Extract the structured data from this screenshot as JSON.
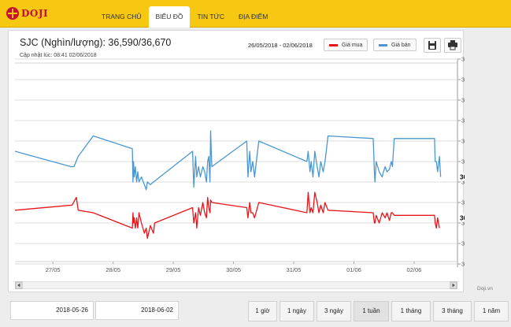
{
  "brand": {
    "name": "DOJI"
  },
  "nav": [
    {
      "label": "TRANG CHỦ"
    },
    {
      "label": "BIỂU ĐỒ"
    },
    {
      "label": "TIN TỨC"
    },
    {
      "label": "ĐỊA ĐIỂM"
    }
  ],
  "active_nav": 1,
  "header": {
    "title": "SJC (Nghìn/lượng): 36,590/36,670",
    "updated": "Cập nhật lúc: 08:41 02/06/2018",
    "date_range": "26/05/2018 - 02/06/2018"
  },
  "legend": {
    "buy_label": "Giá mua",
    "sell_label": "Giá bán"
  },
  "colors": {
    "buy": "#e8161b",
    "sell": "#4a98cf",
    "brand_bar": "#f6c811"
  },
  "icons": {
    "save": "save-icon",
    "print": "print-icon"
  },
  "chart_data": {
    "type": "line",
    "x_ticks": [
      "27/05",
      "28/05",
      "29/05",
      "30/05",
      "31/05",
      "01/06",
      "02/06"
    ],
    "y_ticks": [
      "36,900",
      "36,860",
      "36,820",
      "36,780",
      "36,740",
      "36,700",
      "36,660",
      "36,620",
      "36,580",
      "36,540",
      "36,500"
    ],
    "ylim": [
      36500,
      36900
    ],
    "xlim": [
      0,
      7.35
    ],
    "last_labels": {
      "buy": "36,590",
      "sell": "36,670"
    },
    "series": [
      {
        "name": "Giá bán",
        "color": "#4a98cf",
        "points": [
          [
            0,
            36720
          ],
          [
            0.93,
            36690
          ],
          [
            0.98,
            36690
          ],
          [
            1.05,
            36710
          ],
          [
            1.3,
            36750
          ],
          [
            1.95,
            36725
          ],
          [
            1.96,
            36660
          ],
          [
            1.97,
            36700
          ],
          [
            1.98,
            36670
          ],
          [
            2.0,
            36690
          ],
          [
            2.02,
            36660
          ],
          [
            2.04,
            36680
          ],
          [
            2.06,
            36660
          ],
          [
            2.1,
            36670
          ],
          [
            2.15,
            36655
          ],
          [
            2.18,
            36645
          ],
          [
            2.2,
            36660
          ],
          [
            2.25,
            36655
          ],
          [
            2.3,
            36660
          ],
          [
            2.95,
            36720
          ],
          [
            2.97,
            36650
          ],
          [
            3.0,
            36710
          ],
          [
            3.02,
            36670
          ],
          [
            3.05,
            36690
          ],
          [
            3.08,
            36670
          ],
          [
            3.12,
            36690
          ],
          [
            3.15,
            36680
          ],
          [
            3.18,
            36660
          ],
          [
            3.2,
            36700
          ],
          [
            3.22,
            36710
          ],
          [
            3.24,
            36660
          ],
          [
            3.25,
            36760
          ],
          [
            3.27,
            36690
          ],
          [
            3.85,
            36740
          ],
          [
            3.87,
            36670
          ],
          [
            3.9,
            36720
          ],
          [
            3.92,
            36680
          ],
          [
            3.95,
            36700
          ],
          [
            3.98,
            36670
          ],
          [
            4.05,
            36740
          ],
          [
            4.85,
            36700
          ],
          [
            4.87,
            36720
          ],
          [
            4.9,
            36680
          ],
          [
            4.92,
            36700
          ],
          [
            4.95,
            36670
          ],
          [
            4.98,
            36720
          ],
          [
            5.02,
            36690
          ],
          [
            5.05,
            36670
          ],
          [
            5.08,
            36700
          ],
          [
            5.12,
            36680
          ],
          [
            5.15,
            36700
          ],
          [
            5.2,
            36750
          ],
          [
            5.95,
            36745
          ],
          [
            5.97,
            36680
          ],
          [
            5.98,
            36660
          ],
          [
            6.0,
            36700
          ],
          [
            6.05,
            36680
          ],
          [
            6.1,
            36670
          ],
          [
            6.12,
            36680
          ],
          [
            6.15,
            36690
          ],
          [
            6.18,
            36680
          ],
          [
            6.22,
            36685
          ],
          [
            6.25,
            36700
          ],
          [
            6.27,
            36690
          ],
          [
            6.3,
            36745
          ],
          [
            6.97,
            36745
          ],
          [
            6.98,
            36700
          ],
          [
            7.0,
            36700
          ],
          [
            7.02,
            36680
          ],
          [
            7.05,
            36710
          ],
          [
            7.07,
            36670
          ]
        ]
      },
      {
        "name": "Giá mua",
        "color": "#e8161b",
        "points": [
          [
            0,
            36605
          ],
          [
            0.95,
            36615
          ],
          [
            1.02,
            36630
          ],
          [
            1.05,
            36605
          ],
          [
            1.3,
            36600
          ],
          [
            1.95,
            36570
          ],
          [
            1.96,
            36600
          ],
          [
            1.97,
            36580
          ],
          [
            1.98,
            36590
          ],
          [
            2.0,
            36570
          ],
          [
            2.02,
            36590
          ],
          [
            2.04,
            36570
          ],
          [
            2.06,
            36600
          ],
          [
            2.1,
            36580
          ],
          [
            2.15,
            36560
          ],
          [
            2.18,
            36570
          ],
          [
            2.2,
            36550
          ],
          [
            2.25,
            36575
          ],
          [
            2.3,
            36560
          ],
          [
            2.32,
            36580
          ],
          [
            2.95,
            36610
          ],
          [
            2.97,
            36580
          ],
          [
            3.0,
            36600
          ],
          [
            3.02,
            36570
          ],
          [
            3.05,
            36610
          ],
          [
            3.08,
            36595
          ],
          [
            3.12,
            36620
          ],
          [
            3.15,
            36600
          ],
          [
            3.18,
            36590
          ],
          [
            3.2,
            36630
          ],
          [
            3.22,
            36610
          ],
          [
            3.24,
            36600
          ],
          [
            3.25,
            36625
          ],
          [
            3.27,
            36620
          ],
          [
            3.85,
            36610
          ],
          [
            3.87,
            36590
          ],
          [
            3.9,
            36620
          ],
          [
            3.92,
            36600
          ],
          [
            3.95,
            36600
          ],
          [
            3.98,
            36590
          ],
          [
            4.05,
            36620
          ],
          [
            4.85,
            36600
          ],
          [
            4.87,
            36640
          ],
          [
            4.9,
            36600
          ],
          [
            4.92,
            36610
          ],
          [
            4.95,
            36600
          ],
          [
            4.98,
            36640
          ],
          [
            5.02,
            36620
          ],
          [
            5.05,
            36600
          ],
          [
            5.08,
            36615
          ],
          [
            5.12,
            36600
          ],
          [
            5.15,
            36620
          ],
          [
            5.2,
            36605
          ],
          [
            5.95,
            36600
          ],
          [
            5.97,
            36580
          ],
          [
            5.98,
            36580
          ],
          [
            6.0,
            36595
          ],
          [
            6.05,
            36580
          ],
          [
            6.1,
            36600
          ],
          [
            6.15,
            36590
          ],
          [
            6.18,
            36600
          ],
          [
            6.22,
            36585
          ],
          [
            6.25,
            36600
          ],
          [
            6.27,
            36600
          ],
          [
            6.3,
            36595
          ],
          [
            6.97,
            36595
          ],
          [
            6.98,
            36580
          ],
          [
            7.0,
            36570
          ],
          [
            7.02,
            36590
          ],
          [
            7.05,
            36570
          ]
        ]
      }
    ]
  },
  "credit": "Doji.vn",
  "date_from": "2018-05-26",
  "date_to": "2018-06-02",
  "ranges": [
    {
      "label": "1 giờ"
    },
    {
      "label": "1 ngày"
    },
    {
      "label": "3 ngày"
    },
    {
      "label": "1 tuần"
    },
    {
      "label": "1 tháng"
    },
    {
      "label": "3 tháng"
    },
    {
      "label": "1 năm"
    }
  ],
  "active_range": 3
}
